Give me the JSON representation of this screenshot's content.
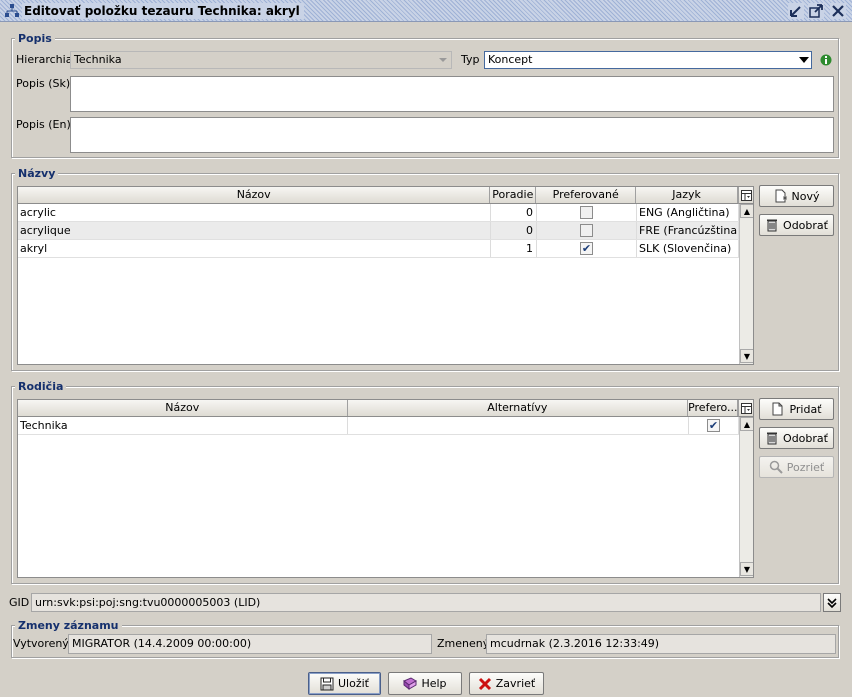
{
  "window": {
    "title": "Editovať položku tezauru Technika: akryl"
  },
  "popis": {
    "group_title": "Popis",
    "hierarchia_label": "Hierarchia",
    "hierarchia_value": "Technika",
    "typ_label": "Typ",
    "typ_value": "Koncept",
    "popis_sk_label": "Popis (Sk)",
    "popis_sk_value": "",
    "popis_en_label": "Popis (En)",
    "popis_en_value": ""
  },
  "nazvy": {
    "group_title": "Názvy",
    "columns": [
      "Názov",
      "Poradie",
      "Preferované",
      "Jazyk"
    ],
    "rows": [
      {
        "nazov": "acrylic",
        "poradie": "0",
        "preferovane": false,
        "jazyk": "ENG (Angličtina)"
      },
      {
        "nazov": "acrylique",
        "poradie": "0",
        "preferovane": false,
        "jazyk": "FRE (Francúzština)"
      },
      {
        "nazov": "akryl",
        "poradie": "1",
        "preferovane": true,
        "jazyk": "SLK (Slovenčina)"
      }
    ],
    "btn_novy": "Nový",
    "btn_odobrat": "Odobrať"
  },
  "rodicia": {
    "group_title": "Rodičia",
    "columns": [
      "Názov",
      "Alternatívy",
      "Prefero..."
    ],
    "rows": [
      {
        "nazov": "Technika",
        "alternativy": "",
        "preferovane": true
      }
    ],
    "btn_pridat": "Pridať",
    "btn_odobrat": "Odobrať",
    "btn_pozriet": "Pozrieť"
  },
  "gid": {
    "label": "GID",
    "value": "urn:svk:psi:poj:sng:tvu0000005003 (LID)"
  },
  "zmeny": {
    "group_title": "Zmeny záznamu",
    "vytvoreny_label": "Vytvorený",
    "vytvoreny_value": "MIGRATOR (14.4.2009 00:00:00)",
    "zmeneny_label": "Zmenený",
    "zmeneny_value": "mcudrnak (2.3.2016 12:33:49)"
  },
  "footer": {
    "ulozit": "Uložiť",
    "help": "Help",
    "zavriet": "Zavrieť"
  },
  "colors": {
    "group_title": "#15306d",
    "info": "#2e8b2e",
    "delete_red": "#cc1111"
  }
}
